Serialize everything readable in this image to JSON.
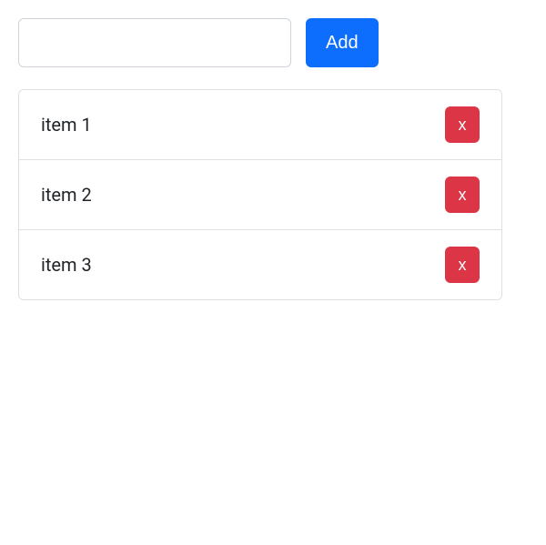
{
  "input": {
    "value": "",
    "placeholder": ""
  },
  "buttons": {
    "add_label": "Add",
    "delete_label": "x"
  },
  "items": [
    {
      "label": "item 1"
    },
    {
      "label": "item 2"
    },
    {
      "label": "item 3"
    }
  ]
}
